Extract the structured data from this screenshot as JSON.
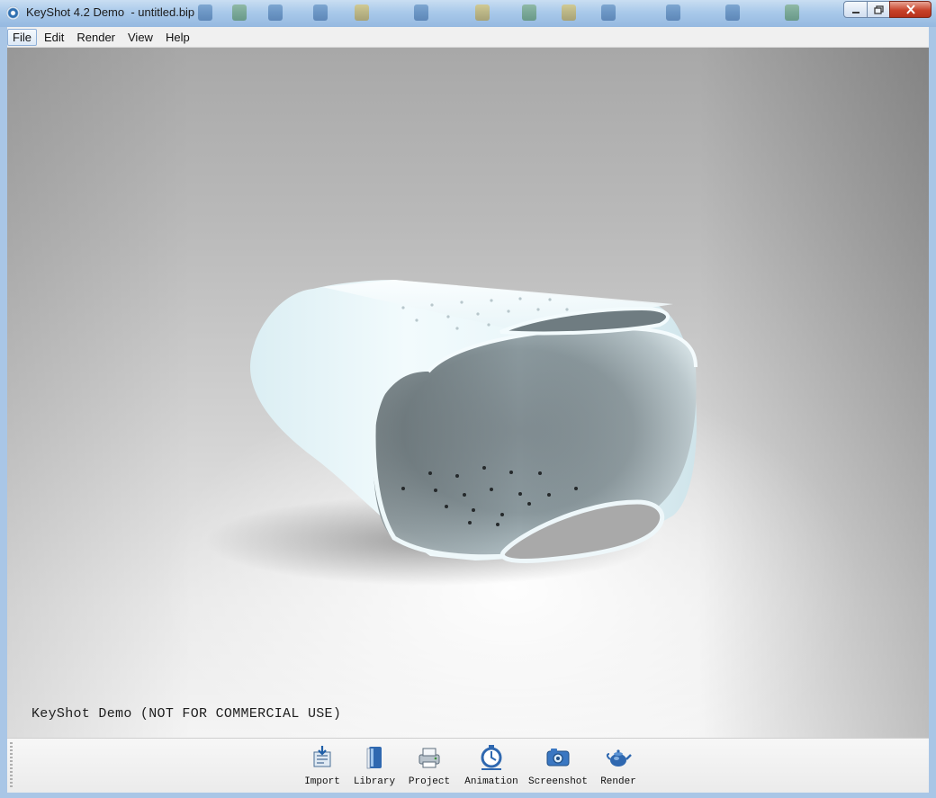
{
  "window": {
    "title": "KeyShot 4.2 Demo  - untitled.bip",
    "controls": {
      "minimize": "—",
      "maximize": "▢",
      "close": "✕"
    }
  },
  "menu": {
    "items": [
      {
        "label": "File"
      },
      {
        "label": "Edit"
      },
      {
        "label": "Render"
      },
      {
        "label": "View"
      },
      {
        "label": "Help"
      }
    ]
  },
  "viewport": {
    "watermark": "KeyShot Demo (NOT FOR COMMERCIAL USE)",
    "model": "sheet-metal-basket"
  },
  "toolbar": {
    "items": [
      {
        "label": "Import",
        "icon": "import-icon"
      },
      {
        "label": "Library",
        "icon": "library-icon"
      },
      {
        "label": "Project",
        "icon": "project-icon"
      },
      {
        "label": "Animation",
        "icon": "animation-icon"
      },
      {
        "label": "Screenshot",
        "icon": "screenshot-icon"
      },
      {
        "label": "Render",
        "icon": "render-icon"
      }
    ]
  },
  "colors": {
    "titlebar": "#a9c9ea",
    "close_button": "#c8432b",
    "menubar": "#f0f0f0",
    "model_outer": "#e8f6fa",
    "model_inner": "#6c7a80"
  }
}
